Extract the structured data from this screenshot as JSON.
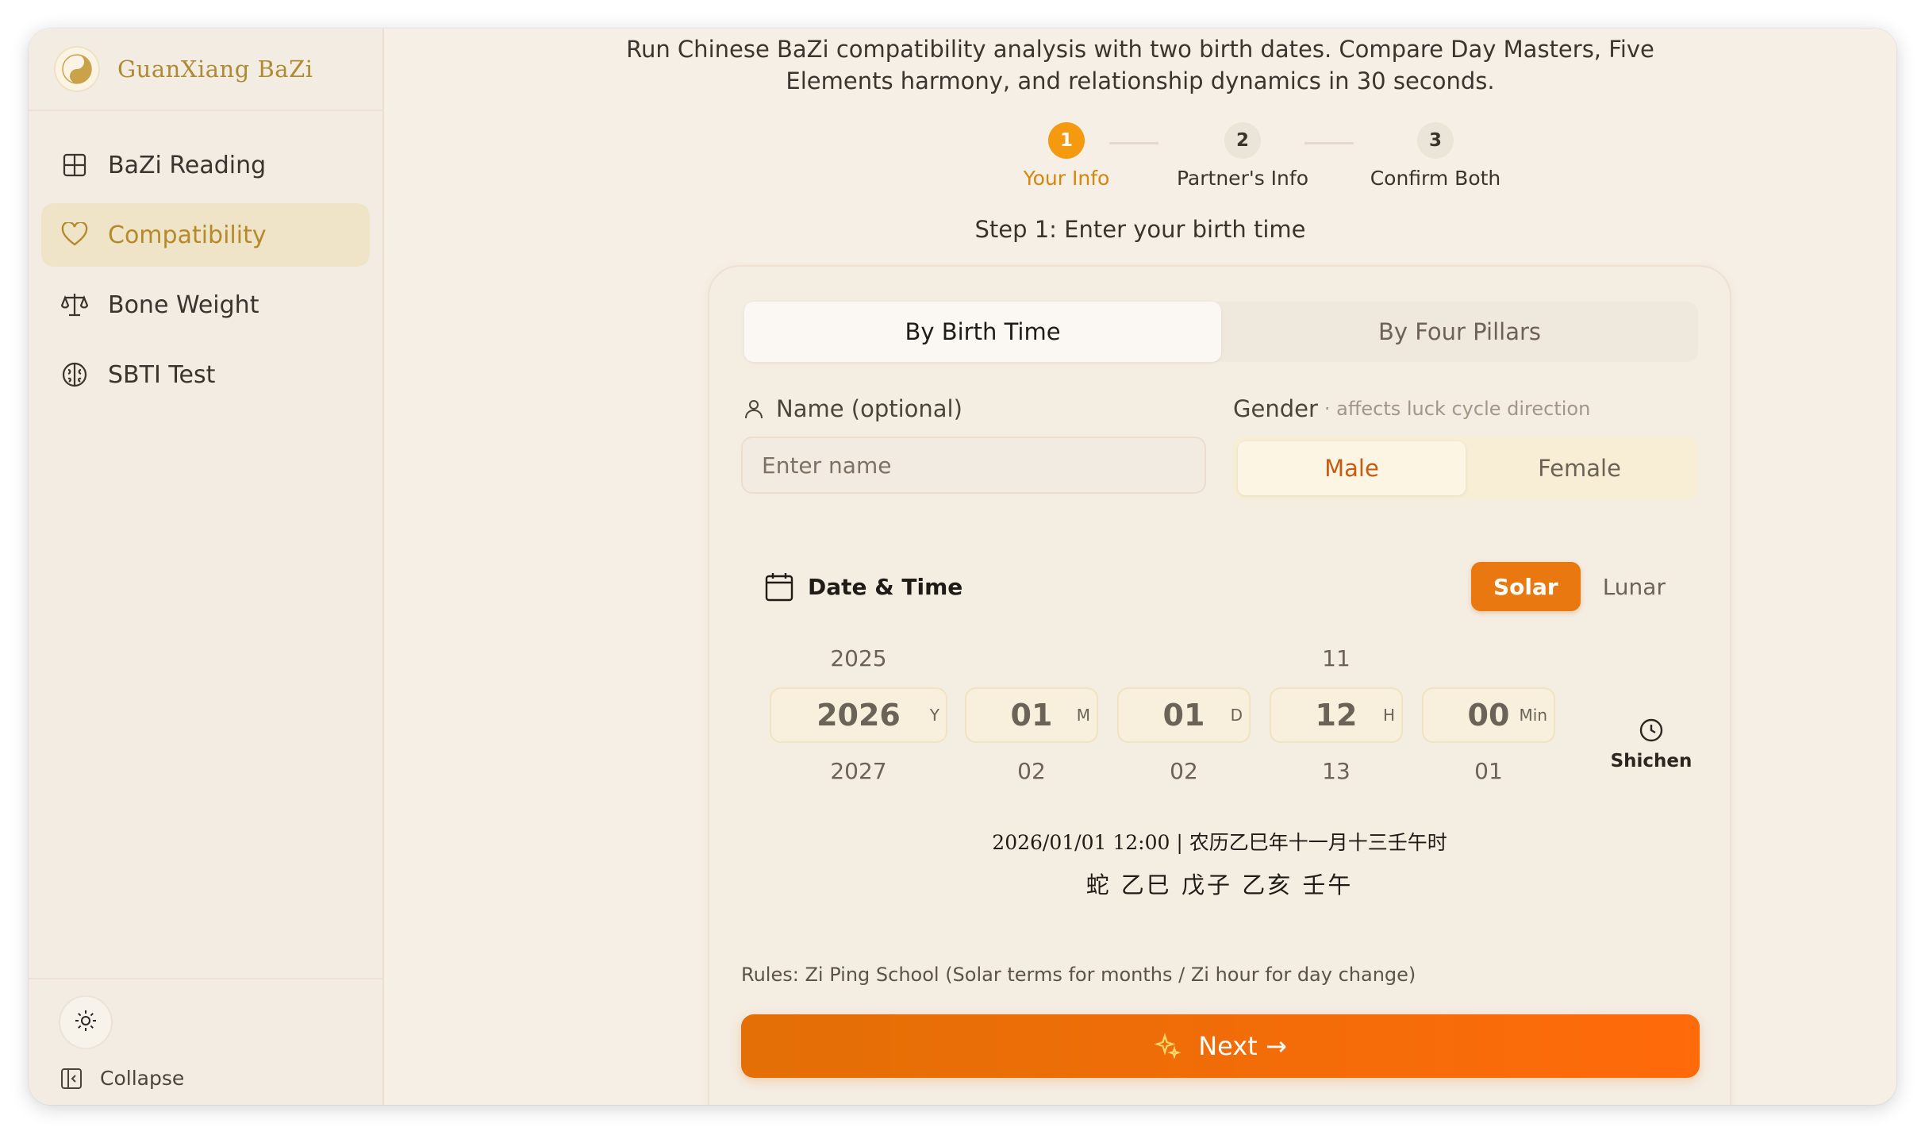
{
  "sidebar": {
    "brand": "GuanXiang BaZi",
    "items": [
      {
        "label": "BaZi Reading",
        "icon": "grid-icon"
      },
      {
        "label": "Compatibility",
        "icon": "heart-icon"
      },
      {
        "label": "Bone Weight",
        "icon": "scale-icon"
      },
      {
        "label": "SBTI Test",
        "icon": "brain-icon"
      }
    ],
    "collapse_label": "Collapse"
  },
  "intro": {
    "line1": "Run Chinese BaZi compatibility analysis with two birth dates. Compare Day Masters, Five",
    "line2": "Elements harmony, and relationship dynamics in 30 seconds."
  },
  "steps": [
    {
      "num": "1",
      "label": "Your Info"
    },
    {
      "num": "2",
      "label": "Partner's Info"
    },
    {
      "num": "3",
      "label": "Confirm Both"
    }
  ],
  "step_caption": "Step 1: Enter your birth time",
  "mode_tabs": [
    "By Birth Time",
    "By Four Pillars"
  ],
  "name": {
    "label": "Name (optional)",
    "placeholder": "Enter name"
  },
  "gender": {
    "label": "Gender",
    "hint": "· affects luck cycle direction",
    "options": [
      "Male",
      "Female"
    ],
    "selected": "Male"
  },
  "datetime": {
    "label": "Date & Time",
    "calendar_options": [
      "Solar",
      "Lunar"
    ],
    "selected": "Solar"
  },
  "picker": [
    {
      "prev": "2025",
      "value": "2026",
      "next": "2027",
      "unit": "Y"
    },
    {
      "prev": "",
      "value": "01",
      "next": "02",
      "unit": "M"
    },
    {
      "prev": "",
      "value": "01",
      "next": "02",
      "unit": "D"
    },
    {
      "prev": "11",
      "value": "12",
      "next": "13",
      "unit": "H"
    },
    {
      "prev": "",
      "value": "00",
      "next": "01",
      "unit": "Min"
    }
  ],
  "shichen_label": "Shichen",
  "summary": {
    "line1": "2026/01/01 12:00  |  农历乙巳年十一月十三壬午时",
    "line2": "蛇 乙巳 戊子 乙亥 壬午"
  },
  "rules": "Rules: Zi Ping School (Solar terms for months / Zi hour for day change)",
  "next_label": "Next →",
  "colors": {
    "accent": "#e8780f",
    "brand": "#b08a33",
    "active_step": "#f59a0e"
  }
}
